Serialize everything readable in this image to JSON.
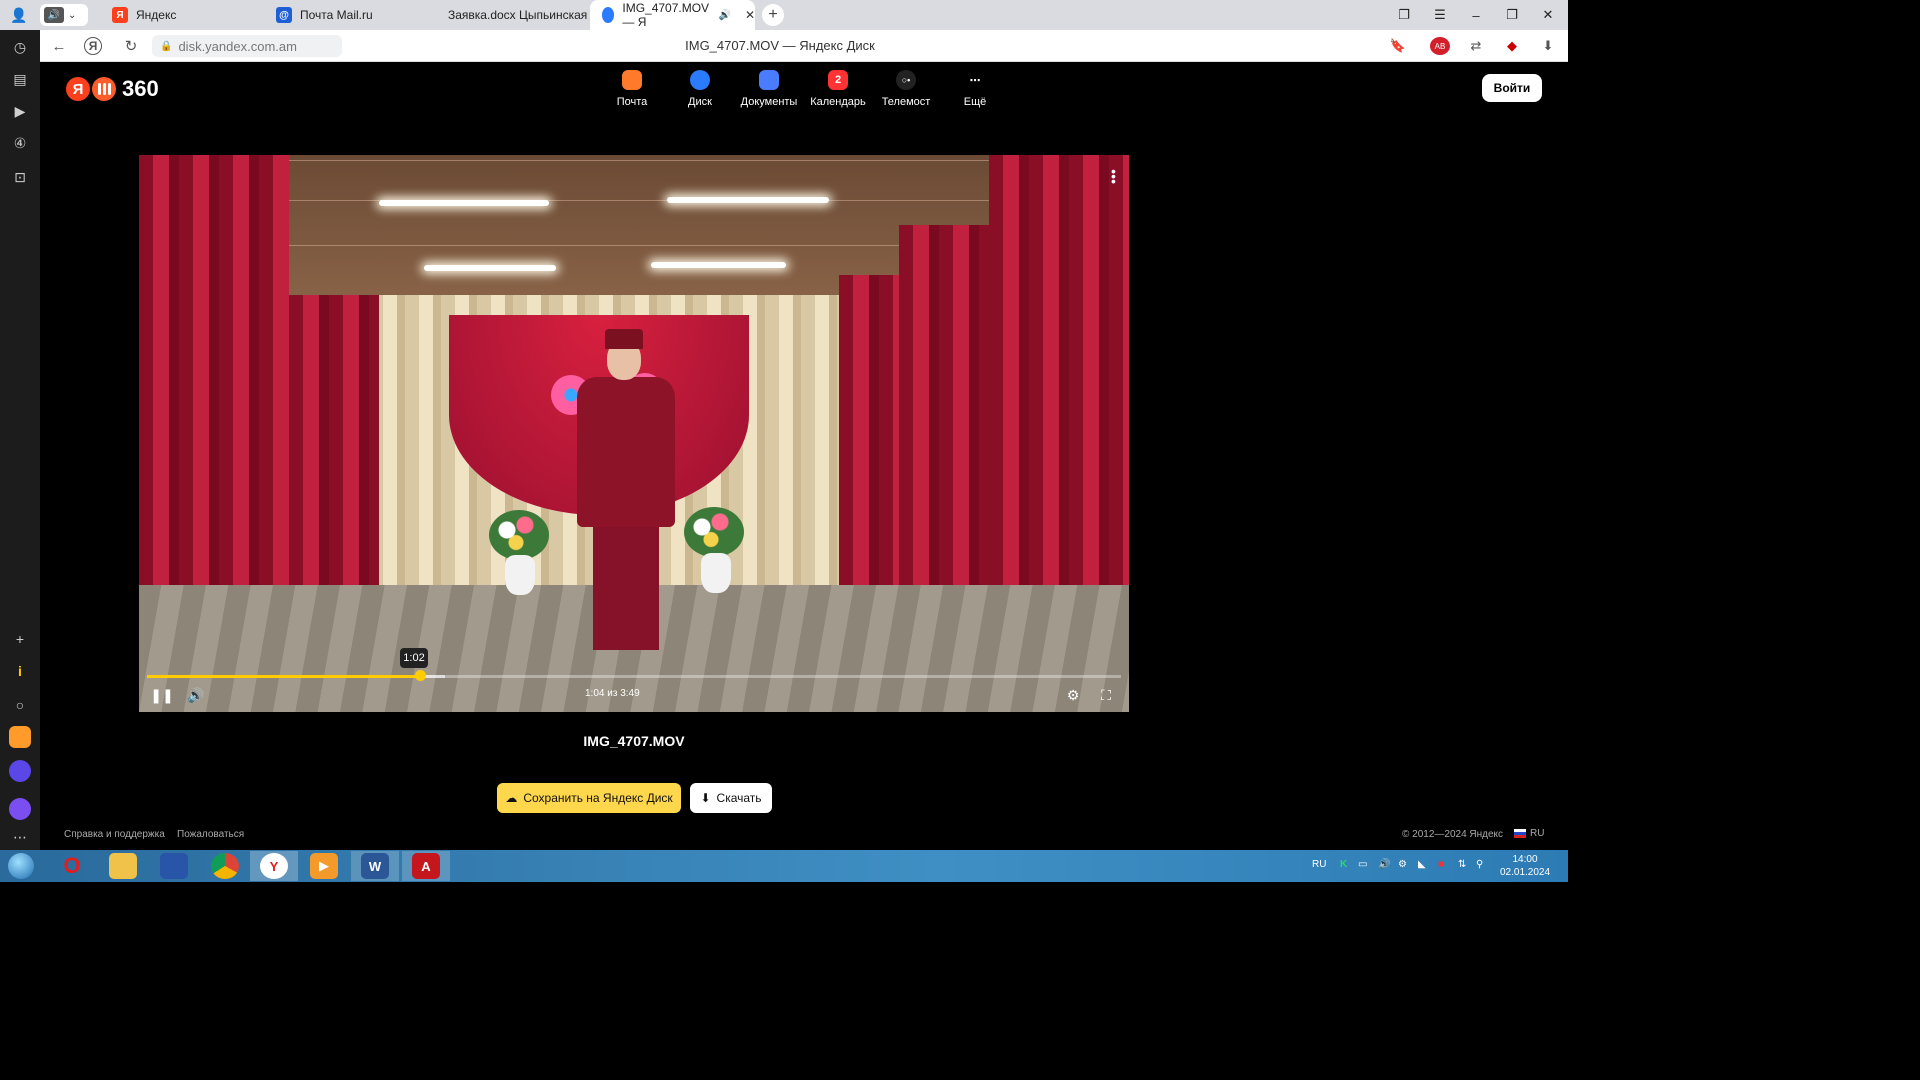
{
  "browser": {
    "tabs": [
      {
        "title": "Яндекс",
        "icon": "yandex-icon"
      },
      {
        "title": "Почта Mail.ru",
        "icon": "mail-ru-icon"
      },
      {
        "title": "Заявка.docx Цыпьинская С",
        "icon": "cloud-icon"
      },
      {
        "title": "IMG_4707.MOV — Я",
        "icon": "yandex-disk-icon"
      }
    ],
    "address": {
      "url": "disk.yandex.com.am",
      "page_title": "IMG_4707.MOV — Яндекс Диск"
    }
  },
  "header": {
    "logo_text": "360",
    "services": [
      {
        "label": "Почта",
        "color": "#ff7a2b"
      },
      {
        "label": "Диск",
        "color": "#2b7bff"
      },
      {
        "label": "Документы",
        "color": "#4a7cff"
      },
      {
        "label": "Календарь",
        "badge": "2",
        "color": "#f33"
      },
      {
        "label": "Телемост",
        "color": "#222"
      },
      {
        "label": "Ещё",
        "color": "transparent"
      }
    ],
    "login_label": "Войти"
  },
  "player": {
    "tooltip_time": "1:02",
    "time_label": "1:04 из 3:49",
    "progress_fraction": 0.28,
    "accent": "#ffcc00"
  },
  "file": {
    "name": "IMG_4707.MOV",
    "save_label": "Сохранить на Яндекс Диск",
    "download_label": "Скачать"
  },
  "footer": {
    "help": "Справка и поддержка",
    "complain": "Пожаловаться",
    "copyright": "© 2012—2024 Яндекс",
    "lang": "RU"
  },
  "taskbar": {
    "lang": "RU",
    "time": "14:00",
    "date": "02.01.2024"
  }
}
